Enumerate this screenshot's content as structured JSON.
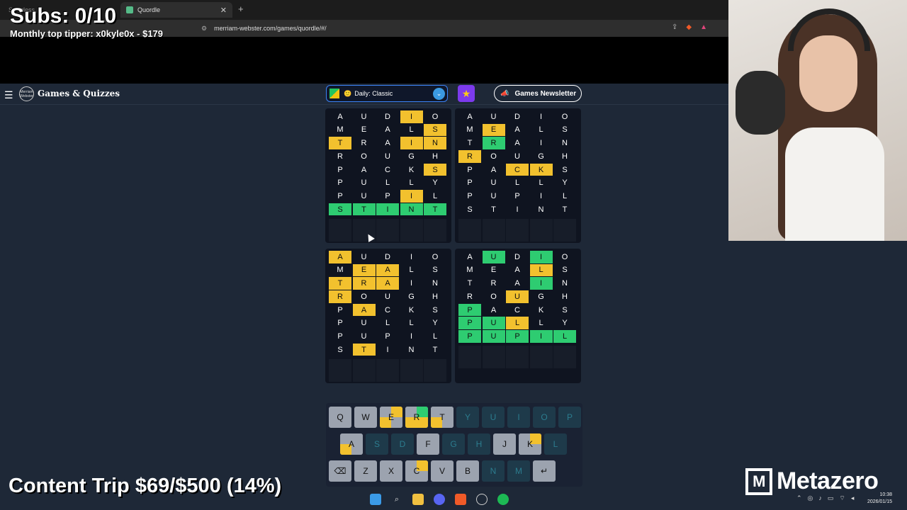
{
  "overlay": {
    "subs": "Subs: 0/10",
    "tipper": "Monthly top tipper: x0kyle0x - $179",
    "content_trip": "Content Trip $69/$500 (14%)",
    "sponsor": "Metazero"
  },
  "browser": {
    "tab_inactive": "Songless",
    "tab_active": "Quordle",
    "url": "merriam-webster.com/games/quordle/#/"
  },
  "site": {
    "title": "Games & Quizzes",
    "logo_text": "Merriam Webster",
    "mode": "Daily: Classic",
    "mode_emoji": "🙂",
    "newsletter": "Games Newsletter"
  },
  "boards": [
    {
      "rows": [
        [
          "A",
          "U",
          "D",
          "I",
          "O"
        ],
        [
          "M",
          "E",
          "A",
          "L",
          "S"
        ],
        [
          "T",
          "R",
          "A",
          "I",
          "N"
        ],
        [
          "R",
          "O",
          "U",
          "G",
          "H"
        ],
        [
          "P",
          "A",
          "C",
          "K",
          "S"
        ],
        [
          "P",
          "U",
          "L",
          "L",
          "Y"
        ],
        [
          "P",
          "U",
          "P",
          "I",
          "L"
        ],
        [
          "S",
          "T",
          "I",
          "N",
          "T"
        ]
      ],
      "colors": [
        "...y.",
        "....y",
        "y..yy",
        ".....",
        "....y",
        ".....",
        "...y.",
        "ggggg"
      ],
      "empty_rows": 1
    },
    {
      "rows": [
        [
          "A",
          "U",
          "D",
          "I",
          "O"
        ],
        [
          "M",
          "E",
          "A",
          "L",
          "S"
        ],
        [
          "T",
          "R",
          "A",
          "I",
          "N"
        ],
        [
          "R",
          "O",
          "U",
          "G",
          "H"
        ],
        [
          "P",
          "A",
          "C",
          "K",
          "S"
        ],
        [
          "P",
          "U",
          "L",
          "L",
          "Y"
        ],
        [
          "P",
          "U",
          "P",
          "I",
          "L"
        ],
        [
          "S",
          "T",
          "I",
          "N",
          "T"
        ]
      ],
      "colors": [
        ".....",
        ".y...",
        ".g...",
        "y....",
        "..yy.",
        ".....",
        ".....",
        "....."
      ],
      "empty_rows": 1
    },
    {
      "rows": [
        [
          "A",
          "U",
          "D",
          "I",
          "O"
        ],
        [
          "M",
          "E",
          "A",
          "L",
          "S"
        ],
        [
          "T",
          "R",
          "A",
          "I",
          "N"
        ],
        [
          "R",
          "O",
          "U",
          "G",
          "H"
        ],
        [
          "P",
          "A",
          "C",
          "K",
          "S"
        ],
        [
          "P",
          "U",
          "L",
          "L",
          "Y"
        ],
        [
          "P",
          "U",
          "P",
          "I",
          "L"
        ],
        [
          "S",
          "T",
          "I",
          "N",
          "T"
        ]
      ],
      "colors": [
        "y....",
        ".yy..",
        "yyy..",
        "y....",
        ".y...",
        ".....",
        ".....",
        ".y..."
      ],
      "empty_rows": 1
    },
    {
      "rows": [
        [
          "A",
          "U",
          "D",
          "I",
          "O"
        ],
        [
          "M",
          "E",
          "A",
          "L",
          "S"
        ],
        [
          "T",
          "R",
          "A",
          "I",
          "N"
        ],
        [
          "R",
          "O",
          "U",
          "G",
          "H"
        ],
        [
          "P",
          "A",
          "C",
          "K",
          "S"
        ],
        [
          "P",
          "U",
          "L",
          "L",
          "Y"
        ],
        [
          "P",
          "U",
          "P",
          "I",
          "L"
        ]
      ],
      "colors": [
        ".g.g.",
        "...y.",
        "...g.",
        "..y..",
        "g....",
        "ggy..",
        "ggggg"
      ],
      "empty_rows": 1
    }
  ],
  "keyboard": {
    "row1": [
      {
        "k": "Q",
        "s": "n"
      },
      {
        "k": "W",
        "s": "n"
      },
      {
        "k": "E",
        "s": "q",
        "tl": "n",
        "tr": "y",
        "bl": "y",
        "br": "n"
      },
      {
        "k": "R",
        "s": "q",
        "tl": "n",
        "tr": "g",
        "bl": "y",
        "br": "y"
      },
      {
        "k": "T",
        "s": "q",
        "tl": "n",
        "tr": "n",
        "bl": "y",
        "br": "n"
      },
      {
        "k": "Y",
        "s": "a"
      },
      {
        "k": "U",
        "s": "a"
      },
      {
        "k": "I",
        "s": "a"
      },
      {
        "k": "O",
        "s": "a"
      },
      {
        "k": "P",
        "s": "a"
      }
    ],
    "row2": [
      {
        "k": "A",
        "s": "q",
        "tl": "n",
        "tr": "n",
        "bl": "y",
        "br": "n"
      },
      {
        "k": "S",
        "s": "a"
      },
      {
        "k": "D",
        "s": "a"
      },
      {
        "k": "F",
        "s": "n"
      },
      {
        "k": "G",
        "s": "a"
      },
      {
        "k": "H",
        "s": "a"
      },
      {
        "k": "J",
        "s": "n"
      },
      {
        "k": "K",
        "s": "q",
        "tl": "n",
        "tr": "y",
        "bl": "n",
        "br": "n"
      },
      {
        "k": "L",
        "s": "a"
      }
    ],
    "row3": [
      {
        "k": "⌫",
        "s": "n"
      },
      {
        "k": "Z",
        "s": "n"
      },
      {
        "k": "X",
        "s": "n"
      },
      {
        "k": "C",
        "s": "q",
        "tl": "n",
        "tr": "y",
        "bl": "n",
        "br": "n"
      },
      {
        "k": "V",
        "s": "n"
      },
      {
        "k": "B",
        "s": "n"
      },
      {
        "k": "N",
        "s": "a"
      },
      {
        "k": "M",
        "s": "a"
      },
      {
        "k": "↵",
        "s": "n"
      }
    ]
  },
  "taskbar": {
    "time": "10:38",
    "date": "2026/01/15"
  },
  "colors": {
    "yellow": "#f2c12e",
    "green": "#2ecc71",
    "neutral_key": "#9ca3af"
  }
}
